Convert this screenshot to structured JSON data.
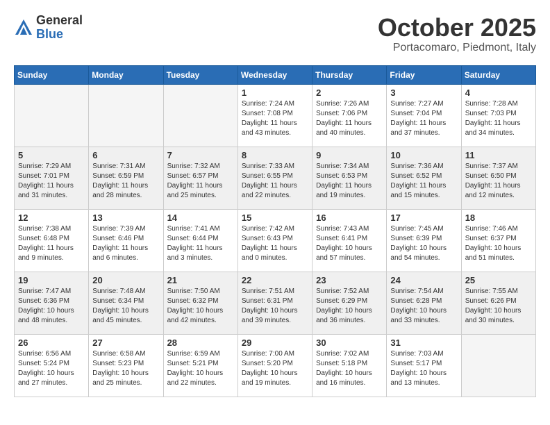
{
  "header": {
    "logo_general": "General",
    "logo_blue": "Blue",
    "month_title": "October 2025",
    "location": "Portacomaro, Piedmont, Italy"
  },
  "days_of_week": [
    "Sunday",
    "Monday",
    "Tuesday",
    "Wednesday",
    "Thursday",
    "Friday",
    "Saturday"
  ],
  "weeks": [
    {
      "shaded": false,
      "days": [
        {
          "num": "",
          "info": ""
        },
        {
          "num": "",
          "info": ""
        },
        {
          "num": "",
          "info": ""
        },
        {
          "num": "1",
          "info": "Sunrise: 7:24 AM\nSunset: 7:08 PM\nDaylight: 11 hours\nand 43 minutes."
        },
        {
          "num": "2",
          "info": "Sunrise: 7:26 AM\nSunset: 7:06 PM\nDaylight: 11 hours\nand 40 minutes."
        },
        {
          "num": "3",
          "info": "Sunrise: 7:27 AM\nSunset: 7:04 PM\nDaylight: 11 hours\nand 37 minutes."
        },
        {
          "num": "4",
          "info": "Sunrise: 7:28 AM\nSunset: 7:03 PM\nDaylight: 11 hours\nand 34 minutes."
        }
      ]
    },
    {
      "shaded": true,
      "days": [
        {
          "num": "5",
          "info": "Sunrise: 7:29 AM\nSunset: 7:01 PM\nDaylight: 11 hours\nand 31 minutes."
        },
        {
          "num": "6",
          "info": "Sunrise: 7:31 AM\nSunset: 6:59 PM\nDaylight: 11 hours\nand 28 minutes."
        },
        {
          "num": "7",
          "info": "Sunrise: 7:32 AM\nSunset: 6:57 PM\nDaylight: 11 hours\nand 25 minutes."
        },
        {
          "num": "8",
          "info": "Sunrise: 7:33 AM\nSunset: 6:55 PM\nDaylight: 11 hours\nand 22 minutes."
        },
        {
          "num": "9",
          "info": "Sunrise: 7:34 AM\nSunset: 6:53 PM\nDaylight: 11 hours\nand 19 minutes."
        },
        {
          "num": "10",
          "info": "Sunrise: 7:36 AM\nSunset: 6:52 PM\nDaylight: 11 hours\nand 15 minutes."
        },
        {
          "num": "11",
          "info": "Sunrise: 7:37 AM\nSunset: 6:50 PM\nDaylight: 11 hours\nand 12 minutes."
        }
      ]
    },
    {
      "shaded": false,
      "days": [
        {
          "num": "12",
          "info": "Sunrise: 7:38 AM\nSunset: 6:48 PM\nDaylight: 11 hours\nand 9 minutes."
        },
        {
          "num": "13",
          "info": "Sunrise: 7:39 AM\nSunset: 6:46 PM\nDaylight: 11 hours\nand 6 minutes."
        },
        {
          "num": "14",
          "info": "Sunrise: 7:41 AM\nSunset: 6:44 PM\nDaylight: 11 hours\nand 3 minutes."
        },
        {
          "num": "15",
          "info": "Sunrise: 7:42 AM\nSunset: 6:43 PM\nDaylight: 11 hours\nand 0 minutes."
        },
        {
          "num": "16",
          "info": "Sunrise: 7:43 AM\nSunset: 6:41 PM\nDaylight: 10 hours\nand 57 minutes."
        },
        {
          "num": "17",
          "info": "Sunrise: 7:45 AM\nSunset: 6:39 PM\nDaylight: 10 hours\nand 54 minutes."
        },
        {
          "num": "18",
          "info": "Sunrise: 7:46 AM\nSunset: 6:37 PM\nDaylight: 10 hours\nand 51 minutes."
        }
      ]
    },
    {
      "shaded": true,
      "days": [
        {
          "num": "19",
          "info": "Sunrise: 7:47 AM\nSunset: 6:36 PM\nDaylight: 10 hours\nand 48 minutes."
        },
        {
          "num": "20",
          "info": "Sunrise: 7:48 AM\nSunset: 6:34 PM\nDaylight: 10 hours\nand 45 minutes."
        },
        {
          "num": "21",
          "info": "Sunrise: 7:50 AM\nSunset: 6:32 PM\nDaylight: 10 hours\nand 42 minutes."
        },
        {
          "num": "22",
          "info": "Sunrise: 7:51 AM\nSunset: 6:31 PM\nDaylight: 10 hours\nand 39 minutes."
        },
        {
          "num": "23",
          "info": "Sunrise: 7:52 AM\nSunset: 6:29 PM\nDaylight: 10 hours\nand 36 minutes."
        },
        {
          "num": "24",
          "info": "Sunrise: 7:54 AM\nSunset: 6:28 PM\nDaylight: 10 hours\nand 33 minutes."
        },
        {
          "num": "25",
          "info": "Sunrise: 7:55 AM\nSunset: 6:26 PM\nDaylight: 10 hours\nand 30 minutes."
        }
      ]
    },
    {
      "shaded": false,
      "days": [
        {
          "num": "26",
          "info": "Sunrise: 6:56 AM\nSunset: 5:24 PM\nDaylight: 10 hours\nand 27 minutes."
        },
        {
          "num": "27",
          "info": "Sunrise: 6:58 AM\nSunset: 5:23 PM\nDaylight: 10 hours\nand 25 minutes."
        },
        {
          "num": "28",
          "info": "Sunrise: 6:59 AM\nSunset: 5:21 PM\nDaylight: 10 hours\nand 22 minutes."
        },
        {
          "num": "29",
          "info": "Sunrise: 7:00 AM\nSunset: 5:20 PM\nDaylight: 10 hours\nand 19 minutes."
        },
        {
          "num": "30",
          "info": "Sunrise: 7:02 AM\nSunset: 5:18 PM\nDaylight: 10 hours\nand 16 minutes."
        },
        {
          "num": "31",
          "info": "Sunrise: 7:03 AM\nSunset: 5:17 PM\nDaylight: 10 hours\nand 13 minutes."
        },
        {
          "num": "",
          "info": ""
        }
      ]
    }
  ]
}
